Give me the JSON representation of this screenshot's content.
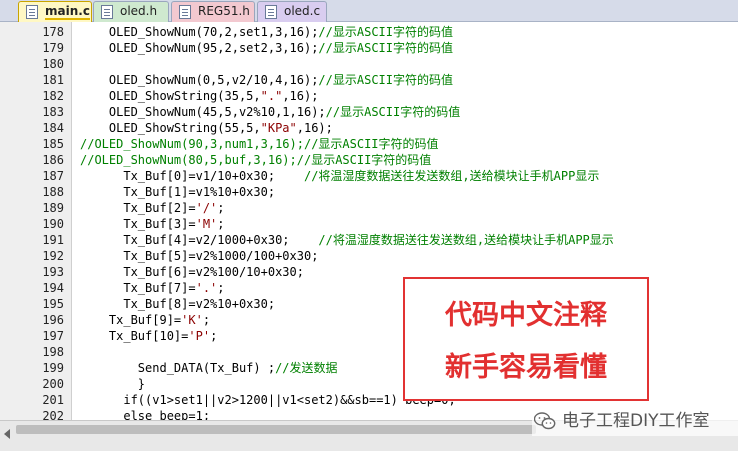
{
  "tabs": [
    {
      "label": "main.c",
      "active": true
    },
    {
      "label": "oled.h",
      "active": false
    },
    {
      "label": "REG51.h",
      "active": false
    },
    {
      "label": "oled.c",
      "active": false
    }
  ],
  "code": {
    "lines": [
      {
        "num": "178",
        "segments": [
          {
            "text": "    OLED_ShowNum(70,2,set1,3,16);",
            "style": "code"
          },
          {
            "text": "//显示ASCII字符的码值",
            "style": "comment"
          }
        ]
      },
      {
        "num": "179",
        "segments": [
          {
            "text": "    OLED_ShowNum(95,2,set2,3,16);",
            "style": "code"
          },
          {
            "text": "//显示ASCII字符的码值",
            "style": "comment"
          }
        ]
      },
      {
        "num": "180",
        "segments": []
      },
      {
        "num": "181",
        "segments": [
          {
            "text": "    OLED_ShowNum(0,5,v2/10,4,16);",
            "style": "code"
          },
          {
            "text": "//显示ASCII字符的码值",
            "style": "comment"
          }
        ]
      },
      {
        "num": "182",
        "segments": [
          {
            "text": "    OLED_ShowString(35,5,",
            "style": "code"
          },
          {
            "text": "\".\"",
            "style": "string"
          },
          {
            "text": ",16);",
            "style": "code"
          }
        ]
      },
      {
        "num": "183",
        "segments": [
          {
            "text": "    OLED_ShowNum(45,5,v2%10,1,16);",
            "style": "code"
          },
          {
            "text": "//显示ASCII字符的码值",
            "style": "comment"
          }
        ]
      },
      {
        "num": "184",
        "segments": [
          {
            "text": "    OLED_ShowString(55,5,",
            "style": "code"
          },
          {
            "text": "\"KPa\"",
            "style": "string"
          },
          {
            "text": ",16);",
            "style": "code"
          }
        ]
      },
      {
        "num": "185",
        "segments": [
          {
            "text": "//OLED_ShowNum(90,3,num1,3,16);//显示ASCII字符的码值",
            "style": "comment"
          }
        ]
      },
      {
        "num": "186",
        "segments": [
          {
            "text": "//OLED_ShowNum(80,5,buf,3,16);//显示ASCII字符的码值",
            "style": "comment"
          }
        ]
      },
      {
        "num": "187",
        "segments": [
          {
            "text": "      Tx_Buf[0]=v1/10+0x30;    ",
            "style": "code"
          },
          {
            "text": "//将温湿度数据送往发送数组,送给模块让手机APP显示",
            "style": "comment"
          }
        ]
      },
      {
        "num": "188",
        "segments": [
          {
            "text": "      Tx_Buf[1]=v1%10+0x30;",
            "style": "code"
          }
        ]
      },
      {
        "num": "189",
        "segments": [
          {
            "text": "      Tx_Buf[2]=",
            "style": "code"
          },
          {
            "text": "'/'",
            "style": "string"
          },
          {
            "text": ";",
            "style": "code"
          }
        ]
      },
      {
        "num": "190",
        "segments": [
          {
            "text": "      Tx_Buf[3]=",
            "style": "code"
          },
          {
            "text": "'M'",
            "style": "string"
          },
          {
            "text": ";",
            "style": "code"
          }
        ]
      },
      {
        "num": "191",
        "segments": [
          {
            "text": "      Tx_Buf[4]=v2/1000+0x30;    ",
            "style": "code"
          },
          {
            "text": "//将温湿度数据送往发送数组,送给模块让手机APP显示",
            "style": "comment"
          }
        ]
      },
      {
        "num": "192",
        "segments": [
          {
            "text": "      Tx_Buf[5]=v2%1000/100+0x30;",
            "style": "code"
          }
        ]
      },
      {
        "num": "193",
        "segments": [
          {
            "text": "      Tx_Buf[6]=v2%100/10+0x30;",
            "style": "code"
          }
        ]
      },
      {
        "num": "194",
        "segments": [
          {
            "text": "      Tx_Buf[7]=",
            "style": "code"
          },
          {
            "text": "'.'",
            "style": "string"
          },
          {
            "text": ";",
            "style": "code"
          }
        ]
      },
      {
        "num": "195",
        "segments": [
          {
            "text": "      Tx_Buf[8]=v2%10+0x30;",
            "style": "code"
          }
        ]
      },
      {
        "num": "196",
        "segments": [
          {
            "text": "    Tx_Buf[9]=",
            "style": "code"
          },
          {
            "text": "'K'",
            "style": "string"
          },
          {
            "text": ";",
            "style": "code"
          }
        ]
      },
      {
        "num": "197",
        "segments": [
          {
            "text": "    Tx_Buf[10]=",
            "style": "code"
          },
          {
            "text": "'P'",
            "style": "string"
          },
          {
            "text": ";",
            "style": "code"
          }
        ]
      },
      {
        "num": "198",
        "segments": []
      },
      {
        "num": "199",
        "segments": [
          {
            "text": "        Send_DATA(Tx_Buf) ;",
            "style": "code"
          },
          {
            "text": "//发送数据",
            "style": "comment"
          }
        ]
      },
      {
        "num": "200",
        "segments": [
          {
            "text": "        }",
            "style": "code"
          }
        ]
      },
      {
        "num": "201",
        "segments": [
          {
            "text": "      if((v1>set1||v2>1200||v1<set2)&&sb==1) beep=0;",
            "style": "code"
          }
        ]
      },
      {
        "num": "202",
        "segments": [
          {
            "text": "      else beep=1;",
            "style": "code"
          }
        ]
      }
    ]
  },
  "annotation": {
    "line1": "代码中文注释",
    "line2": "新手容易看懂",
    "color": "#e23030"
  },
  "watermark": {
    "text": "电子工程DIY工作室",
    "icon": "wechat-icon"
  },
  "colors": {
    "comment": "#008000",
    "string": "#8b0000",
    "code": "#000000",
    "gutter_bg": "#efefef"
  }
}
